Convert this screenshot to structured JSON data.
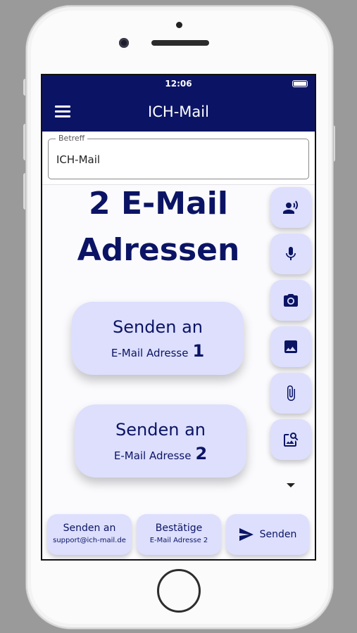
{
  "status_bar": {
    "time": "12:06"
  },
  "app_bar": {
    "title": "ICH-Mail"
  },
  "subject": {
    "label": "Betreff",
    "value": "ICH-Mail"
  },
  "headline": {
    "line1": "2 E-Mail",
    "line2": "Adressen"
  },
  "send_cards": [
    {
      "line1": "Senden an",
      "line2": "E-Mail Adresse",
      "number": "1"
    },
    {
      "line1": "Senden an",
      "line2": "E-Mail Adresse",
      "number": "2"
    }
  ],
  "side_actions": [
    {
      "icon": "voice-contact-icon"
    },
    {
      "icon": "microphone-icon"
    },
    {
      "icon": "camera-icon"
    },
    {
      "icon": "image-icon"
    },
    {
      "icon": "attachment-icon"
    },
    {
      "icon": "image-search-icon"
    },
    {
      "icon": "chevron-down-icon"
    }
  ],
  "bottom_bar": {
    "support": {
      "line1": "Senden an",
      "line2": "support@ich-mail.de"
    },
    "confirm": {
      "line1": "Bestätige",
      "line2": "E-Mail Adresse 2"
    },
    "send": {
      "label": "Senden"
    }
  },
  "colors": {
    "primary": "#0b1464",
    "button_bg": "#dddffd",
    "screen_bg": "#fbfbfe"
  }
}
